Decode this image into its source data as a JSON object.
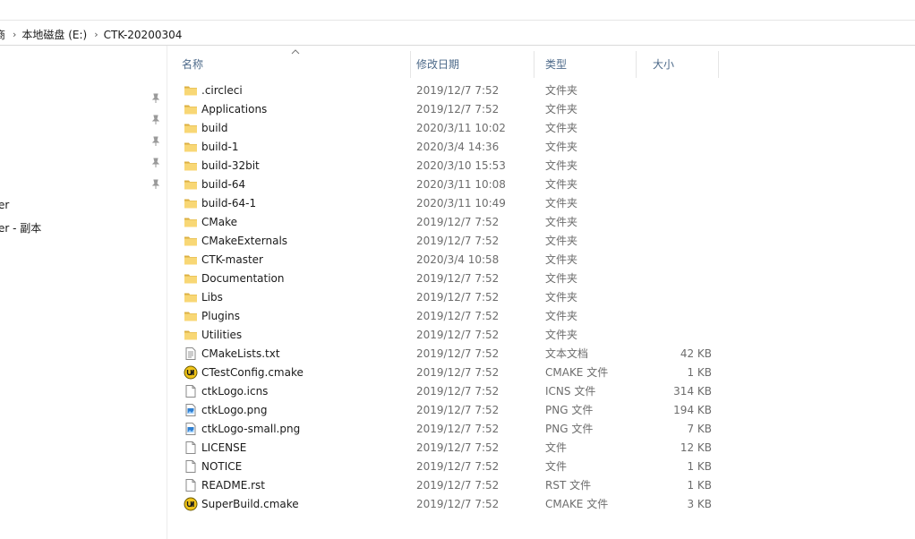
{
  "breadcrumb": {
    "items": [
      "商",
      "本地磁盘 (E:)",
      "CTK-20200304"
    ]
  },
  "nav": {
    "items": [
      "er",
      "er - 副本"
    ]
  },
  "columns": {
    "name": "名称",
    "date": "修改日期",
    "type": "类型",
    "size": "大小"
  },
  "files": [
    {
      "name": ".circleci",
      "date": "2019/12/7 7:52",
      "type": "文件夹",
      "size": "",
      "icon": "folder-icon"
    },
    {
      "name": "Applications",
      "date": "2019/12/7 7:52",
      "type": "文件夹",
      "size": "",
      "icon": "folder-icon"
    },
    {
      "name": "build",
      "date": "2020/3/11 10:02",
      "type": "文件夹",
      "size": "",
      "icon": "folder-icon"
    },
    {
      "name": "build-1",
      "date": "2020/3/4 14:36",
      "type": "文件夹",
      "size": "",
      "icon": "folder-icon"
    },
    {
      "name": "build-32bit",
      "date": "2020/3/10 15:53",
      "type": "文件夹",
      "size": "",
      "icon": "folder-icon"
    },
    {
      "name": "build-64",
      "date": "2020/3/11 10:08",
      "type": "文件夹",
      "size": "",
      "icon": "folder-icon"
    },
    {
      "name": "build-64-1",
      "date": "2020/3/11 10:49",
      "type": "文件夹",
      "size": "",
      "icon": "folder-icon"
    },
    {
      "name": "CMake",
      "date": "2019/12/7 7:52",
      "type": "文件夹",
      "size": "",
      "icon": "folder-icon"
    },
    {
      "name": "CMakeExternals",
      "date": "2019/12/7 7:52",
      "type": "文件夹",
      "size": "",
      "icon": "folder-icon"
    },
    {
      "name": "CTK-master",
      "date": "2020/3/4 10:58",
      "type": "文件夹",
      "size": "",
      "icon": "folder-icon"
    },
    {
      "name": "Documentation",
      "date": "2019/12/7 7:52",
      "type": "文件夹",
      "size": "",
      "icon": "folder-icon"
    },
    {
      "name": "Libs",
      "date": "2019/12/7 7:52",
      "type": "文件夹",
      "size": "",
      "icon": "folder-icon"
    },
    {
      "name": "Plugins",
      "date": "2019/12/7 7:52",
      "type": "文件夹",
      "size": "",
      "icon": "folder-icon"
    },
    {
      "name": "Utilities",
      "date": "2019/12/7 7:52",
      "type": "文件夹",
      "size": "",
      "icon": "folder-icon"
    },
    {
      "name": "CMakeLists.txt",
      "date": "2019/12/7 7:52",
      "type": "文本文档",
      "size": "42 KB",
      "icon": "text-file-icon"
    },
    {
      "name": "CTestConfig.cmake",
      "date": "2019/12/7 7:52",
      "type": "CMAKE 文件",
      "size": "1 KB",
      "icon": "cmake-file-icon"
    },
    {
      "name": "ctkLogo.icns",
      "date": "2019/12/7 7:52",
      "type": "ICNS 文件",
      "size": "314 KB",
      "icon": "blank-file-icon"
    },
    {
      "name": "ctkLogo.png",
      "date": "2019/12/7 7:52",
      "type": "PNG 文件",
      "size": "194 KB",
      "icon": "image-file-icon"
    },
    {
      "name": "ctkLogo-small.png",
      "date": "2019/12/7 7:52",
      "type": "PNG 文件",
      "size": "7 KB",
      "icon": "image-file-icon"
    },
    {
      "name": "LICENSE",
      "date": "2019/12/7 7:52",
      "type": "文件",
      "size": "12 KB",
      "icon": "blank-file-icon"
    },
    {
      "name": "NOTICE",
      "date": "2019/12/7 7:52",
      "type": "文件",
      "size": "1 KB",
      "icon": "blank-file-icon"
    },
    {
      "name": "README.rst",
      "date": "2019/12/7 7:52",
      "type": "RST 文件",
      "size": "1 KB",
      "icon": "blank-file-icon"
    },
    {
      "name": "SuperBuild.cmake",
      "date": "2019/12/7 7:52",
      "type": "CMAKE 文件",
      "size": "3 KB",
      "icon": "cmake-file-icon"
    }
  ],
  "colors": {
    "header_text": "#4d6a8a",
    "folder": "#f8d775",
    "secondary_text": "#6d6d6d"
  }
}
